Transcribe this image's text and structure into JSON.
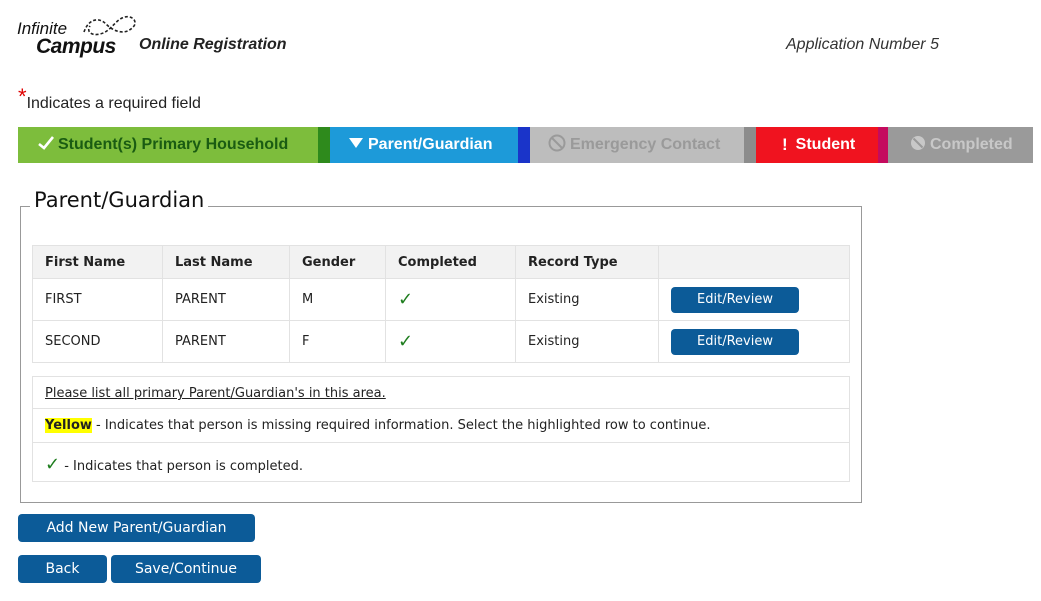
{
  "header": {
    "logo_line1": "Infinite",
    "logo_line2": "Campus",
    "app_title": "Online Registration",
    "application_number": "Application Number 5"
  },
  "required_note": {
    "star": "*",
    "text": "Indicates a required field"
  },
  "steps": [
    {
      "label": "Student(s) Primary Household",
      "icon": "check-icon",
      "status": "complete",
      "color": "#7dbd3c"
    },
    {
      "label": "Parent/Guardian",
      "icon": "triangle-down-icon",
      "status": "current",
      "color": "#1d9ad9"
    },
    {
      "label": "Emergency Contact",
      "icon": "no-entry-icon",
      "status": "disabled",
      "color": "#bdbdbd"
    },
    {
      "label": "Student",
      "icon": "exclamation-icon",
      "status": "error",
      "color": "#f0131f"
    },
    {
      "label": "Completed",
      "icon": "no-entry-icon",
      "status": "disabled",
      "color": "#9a9a9a"
    }
  ],
  "section": {
    "title": "Parent/Guardian",
    "table": {
      "columns": [
        "First Name",
        "Last Name",
        "Gender",
        "Completed",
        "Record Type",
        ""
      ],
      "rows": [
        {
          "first": "FIRST",
          "last": "PARENT",
          "gender": "M",
          "completed": "✓",
          "record_type": "Existing",
          "action": "Edit/Review"
        },
        {
          "first": "SECOND",
          "last": "PARENT",
          "gender": "F",
          "completed": "✓",
          "record_type": "Existing",
          "action": "Edit/Review"
        }
      ]
    },
    "info": {
      "line1": "Please list all primary Parent/Guardian's in this area.",
      "yellow_word": "Yellow",
      "line2": " - Indicates that person is missing required information. Select the highlighted row to continue.",
      "check_mark": "✓",
      "line3": " - Indicates that person is completed."
    }
  },
  "buttons": {
    "add": "Add New Parent/Guardian",
    "back": "Back",
    "save": "Save/Continue"
  },
  "colors": {
    "button_blue": "#0c5b98",
    "check_green": "#1e7d1e",
    "required_red": "#e00000",
    "highlight_yellow": "#ffff00"
  }
}
